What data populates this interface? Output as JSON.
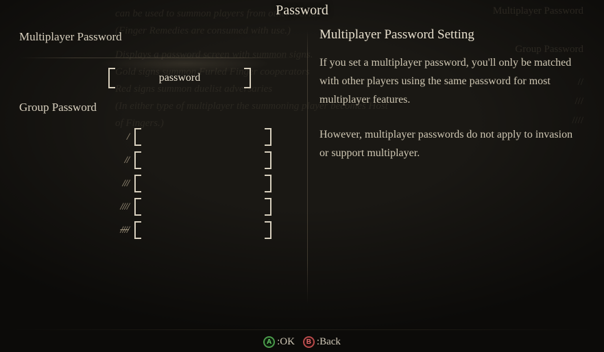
{
  "title": "Password",
  "left": {
    "mp_label": "Multiplayer Password",
    "mp_value": "password",
    "gp_label": "Group Password",
    "group_slots": [
      {
        "tally": "/",
        "value": ""
      },
      {
        "tally": "//",
        "value": ""
      },
      {
        "tally": "///",
        "value": ""
      },
      {
        "tally": "////",
        "value": ""
      },
      {
        "tally": "////",
        "value": ""
      }
    ]
  },
  "right": {
    "heading": "Multiplayer Password Setting",
    "para1": "If you set a multiplayer password, you'll only be matched with other players using the same password for most multiplayer features.",
    "para2": "However, multiplayer passwords do not apply to invasion or support multiplayer."
  },
  "footer": {
    "ok_glyph": "A",
    "ok_label": ":OK",
    "back_glyph": "B",
    "back_label": ":Back"
  },
  "bg": {
    "l1": "can be used to summon players from other worlds",
    "l2": "(Finger Remedies are consumed with use.)",
    "l3": "Displays a password screen with summon signs.",
    "l4": "Gold signs summon Furled Finger cooperators",
    "l5": "Red signs summon duelist adversaries",
    "l6": "(In either type of multiplayer the summoning player becomes Host",
    "l7": "of Fingers.)",
    "r1": "Multiplayer Password",
    "r2": "Group Password",
    "r3": "//",
    "r4": "///",
    "r5": "////"
  }
}
